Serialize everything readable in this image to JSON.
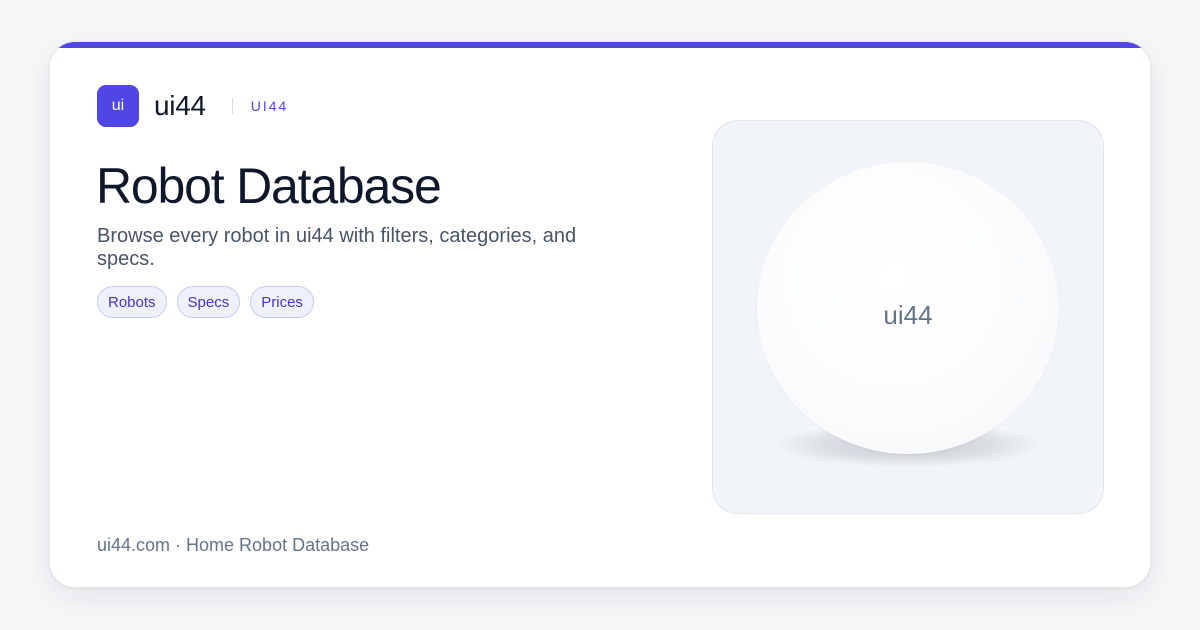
{
  "brand": {
    "logo_text": "ui",
    "name": "ui44",
    "tag": "UI44"
  },
  "hero": {
    "title": "Robot Database",
    "subtitle": "Browse every robot in ui44 with filters, categories, and specs."
  },
  "chips": [
    {
      "label": "Robots"
    },
    {
      "label": "Specs"
    },
    {
      "label": "Prices"
    }
  ],
  "preview": {
    "label": "ui44"
  },
  "footer": {
    "text": "ui44.com · Home Robot Database"
  },
  "colors": {
    "accent": "#4f46e5",
    "title": "#0f172a",
    "muted": "#64748b",
    "page_background": "#f6f7f9",
    "card_background": "#ffffff",
    "chip_background": "#eef0fc"
  }
}
